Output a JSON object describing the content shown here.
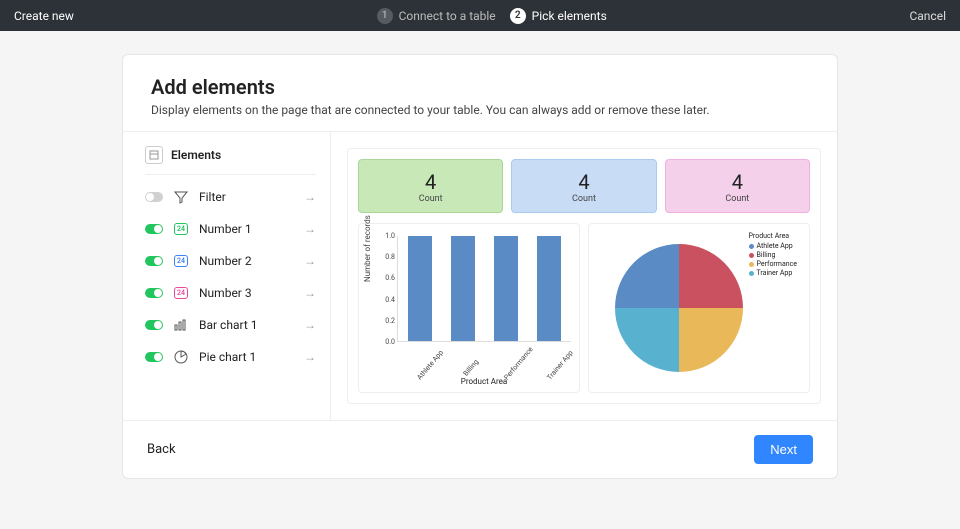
{
  "topbar": {
    "title": "Create new",
    "steps": [
      {
        "num": "1",
        "label": "Connect to a table",
        "active": false
      },
      {
        "num": "2",
        "label": "Pick elements",
        "active": true
      }
    ],
    "cancel": "Cancel"
  },
  "header": {
    "title": "Add elements",
    "subtitle": "Display elements on the page that are connected to your table. You can always add or remove these later."
  },
  "sidebar": {
    "header": "Elements",
    "items": [
      {
        "label": "Filter",
        "enabled": false,
        "icon": "funnel"
      },
      {
        "label": "Number 1",
        "enabled": true,
        "icon": "num-green"
      },
      {
        "label": "Number 2",
        "enabled": true,
        "icon": "num-blue"
      },
      {
        "label": "Number 3",
        "enabled": true,
        "icon": "num-pink"
      },
      {
        "label": "Bar chart 1",
        "enabled": true,
        "icon": "bars"
      },
      {
        "label": "Pie chart 1",
        "enabled": true,
        "icon": "pie"
      }
    ]
  },
  "counters": [
    {
      "value": "4",
      "label": "Count",
      "color": "green"
    },
    {
      "value": "4",
      "label": "Count",
      "color": "blue"
    },
    {
      "value": "4",
      "label": "Count",
      "color": "pink"
    }
  ],
  "chart_data": [
    {
      "type": "bar",
      "categories": [
        "Athlete App",
        "Billing",
        "Performance",
        "Trainer App"
      ],
      "values": [
        1.0,
        1.0,
        1.0,
        1.0
      ],
      "ylabel": "Number of records",
      "xlabel": "Product Area",
      "ylim": [
        0.0,
        1.0
      ],
      "yticks": [
        0.0,
        0.2,
        0.4,
        0.6,
        0.8,
        1.0
      ],
      "bar_color": "#5b8bc4"
    },
    {
      "type": "pie",
      "legend_title": "Product Area",
      "series": [
        {
          "name": "Athlete App",
          "value": 1,
          "color": "#5b8bc4"
        },
        {
          "name": "Billing",
          "value": 1,
          "color": "#c95160"
        },
        {
          "name": "Performance",
          "value": 1,
          "color": "#e9b959"
        },
        {
          "name": "Trainer App",
          "value": 1,
          "color": "#58b2cf"
        }
      ]
    }
  ],
  "footer": {
    "back": "Back",
    "next": "Next"
  }
}
